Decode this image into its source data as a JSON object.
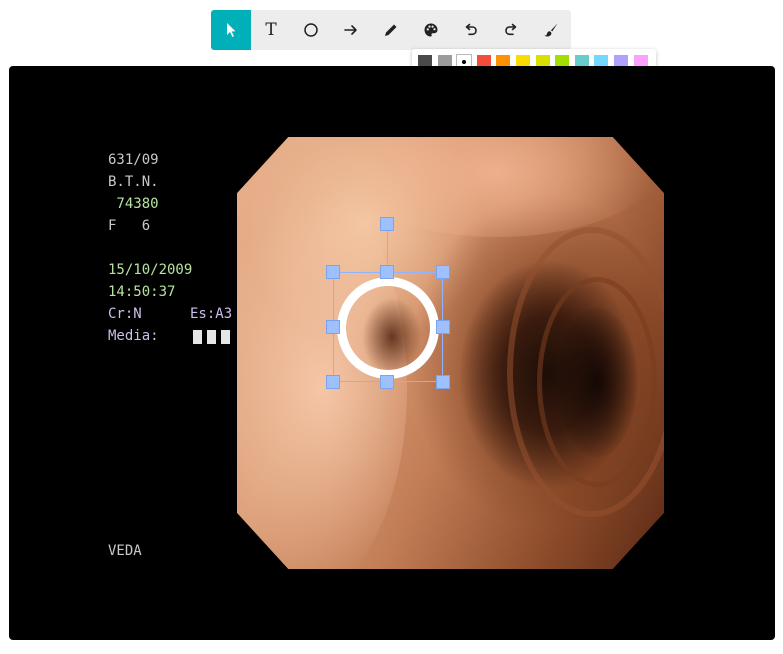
{
  "toolbar": {
    "tools": [
      {
        "name": "select",
        "icon": "cursor-arrow-icon",
        "active": true
      },
      {
        "name": "text",
        "icon": "text-icon",
        "glyph": "T"
      },
      {
        "name": "circle",
        "icon": "circle-icon"
      },
      {
        "name": "arrow",
        "icon": "arrow-right-icon"
      },
      {
        "name": "pencil",
        "icon": "pencil-icon"
      },
      {
        "name": "palette",
        "icon": "palette-icon"
      },
      {
        "name": "undo",
        "icon": "undo-icon"
      },
      {
        "name": "redo",
        "icon": "redo-icon"
      },
      {
        "name": "brush",
        "icon": "brush-icon"
      }
    ],
    "accent_color": "#00b0b8"
  },
  "palette": {
    "selected": "#ffffff",
    "rows": [
      [
        "#4a4a4a",
        "#9b9b9b",
        "#ffffff",
        "#f44e3b",
        "#fe9200",
        "#fcdc00",
        "#dbdf00",
        "#a4dd00",
        "#68ccca",
        "#73d8ff",
        "#aea1ff",
        "#fda1ff"
      ],
      [
        "#333333",
        "#808080",
        "#cccccc",
        "#d33115",
        "#e27300",
        "#fcc400",
        "#b0bc00",
        "#68bc00",
        "#16a5a5",
        "#009ce0",
        "#7b64ff",
        "#fa28ff"
      ],
      [
        "#000000",
        "#666666",
        "#b3b3b3",
        "#9f0500",
        "#c45100",
        "#fb9e00",
        "#808900",
        "#194d33",
        "#0c797d",
        "#0062b1",
        "#653294",
        "#ab149e"
      ]
    ]
  },
  "image_overlay": {
    "study_id": "631/09",
    "patient_initials": "B.T.N.",
    "patient_number": " 74380",
    "sex_age": "F   6",
    "date": "15/10/2009",
    "time": "14:50:37",
    "cr_label": "Cr:N",
    "enh_label": "Es:A3",
    "media_label": "Media:",
    "brand": "VEDA"
  }
}
